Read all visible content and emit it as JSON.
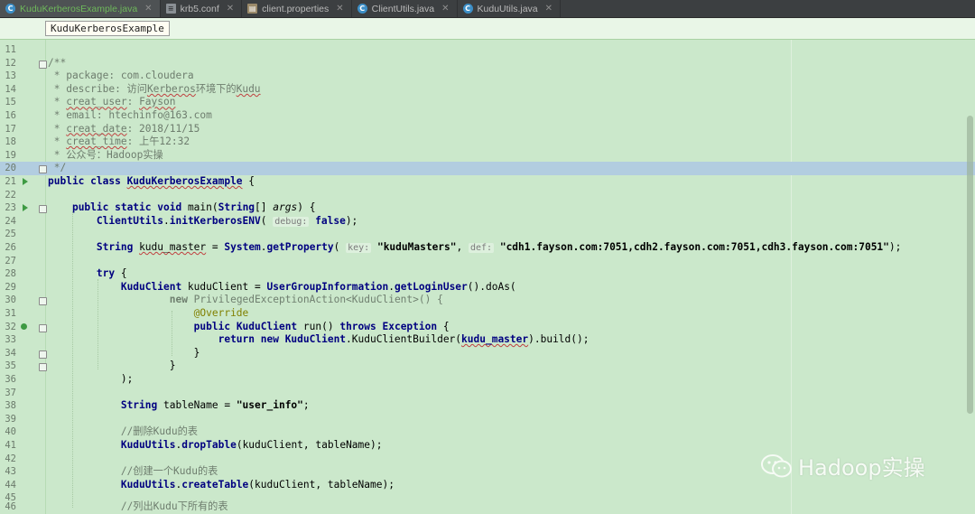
{
  "tabs": [
    {
      "label": "KuduKerberosExample.java",
      "icon": "java-class-icon",
      "active": true
    },
    {
      "label": "krb5.conf",
      "icon": "text-file-icon",
      "active": false
    },
    {
      "label": "client.properties",
      "icon": "properties-file-icon",
      "active": false
    },
    {
      "label": "ClientUtils.java",
      "icon": "java-class-icon",
      "active": false
    },
    {
      "label": "KuduUtils.java",
      "icon": "java-class-icon",
      "active": false
    }
  ],
  "breadcrumb": {
    "label": "KuduKerberosExample"
  },
  "editor": {
    "line_numbers": [
      "11",
      "12",
      "13",
      "14",
      "15",
      "16",
      "17",
      "18",
      "19",
      "20",
      "21",
      "22",
      "23",
      "24",
      "25",
      "26",
      "27",
      "28",
      "29",
      "30",
      "31",
      "32",
      "33",
      "34",
      "35",
      "36",
      "37",
      "38",
      "39",
      "40",
      "41",
      "42",
      "43",
      "44",
      "45",
      "46"
    ],
    "javadoc": {
      "open": "/**",
      "package": " * package: com.cloudera",
      "describe_prefix": " * describe: 访问",
      "describe_kerberos": "Kerberos",
      "describe_mid": "环境下的",
      "describe_kudu": "Kudu",
      "creat_user_prefix": " * ",
      "creat_user_key": "creat_user",
      "creat_user_sep": ": ",
      "creat_user_value": "Fayson",
      "email": " * email: htechinfo@163.com",
      "creat_date_key": "creat_date",
      "creat_date_value": ": 2018/11/15",
      "creat_time_key": "creat_time",
      "creat_time_value": ": 上午12:32",
      "wechat": " * 公众号：Hadoop实操",
      "close": " */"
    },
    "class_decl": {
      "kw": "public class ",
      "name": "KuduKerberosExample",
      "rest": " {"
    },
    "main_decl": {
      "kw": "public static void ",
      "name": "main(",
      "type": "String",
      "rest1": "[] ",
      "args": "args",
      "rest2": ") {"
    },
    "init_call": {
      "cls": "ClientUtils",
      "dot": ".",
      "method": "initKerberosENV",
      "open": "( ",
      "hint": "debug:",
      "val": " false",
      "close": ");"
    },
    "master_line": {
      "type": "String",
      "var": "kudu_master",
      "eq": " = ",
      "sys": "System",
      "dot": ".",
      "method": "getProperty",
      "open": "( ",
      "hint_key": "key:",
      "key": " \"kuduMasters\"",
      "comma": ", ",
      "hint_def": "def:",
      "def": " \"cdh1.fayson.com:7051,cdh2.fayson.com:7051,cdh3.fayson.com:7051\"",
      "close": ");"
    },
    "try_line": {
      "kw": "try",
      "rest": " {"
    },
    "client_line": {
      "type": "KuduClient",
      "rest": " kuduClient = ",
      "cls": "UserGroupInformation",
      "dot": ".",
      "method": "getLoginUser",
      "tail": "().doAs("
    },
    "new_line": {
      "kw": "new ",
      "rest": "PrivilegedExceptionAction<KuduClient>() {"
    },
    "override_line": {
      "anno": "@Override"
    },
    "run_line": {
      "kw": "public ",
      "type": "KuduClient",
      "name": " run() ",
      "throws": "throws ",
      "exc": "Exception",
      "rest": " {"
    },
    "return_line": {
      "kw": "return new ",
      "cls": "KuduClient",
      "rest1": ".KuduClientBuilder(",
      "var": "kudu_master",
      "rest2": ").build();"
    },
    "brace_inner": "}",
    "brace_outer": "}",
    "close_paren": ");",
    "table_line": {
      "type": "String",
      "rest": " tableName = ",
      "val": "\"user_info\"",
      "end": ";"
    },
    "cm_drop": "//删除Kudu的表",
    "drop_line": {
      "cls": "KuduUtils",
      "dot": ".",
      "method": "dropTable",
      "rest": "(kuduClient, tableName);"
    },
    "cm_create": "//创建一个Kudu的表",
    "create_line": {
      "cls": "KuduUtils",
      "dot": ".",
      "method": "createTable",
      "rest": "(kuduClient, tableName);"
    },
    "cm_list": "//列出Kudu下所有的表"
  },
  "watermark": {
    "text": "Hadoop实操",
    "icon": "wechat-icon"
  },
  "colors": {
    "background": "#cbe8cb",
    "current_line": "#b2cde0",
    "keyword": "#000080",
    "tab_bar": "#3c3f41"
  }
}
